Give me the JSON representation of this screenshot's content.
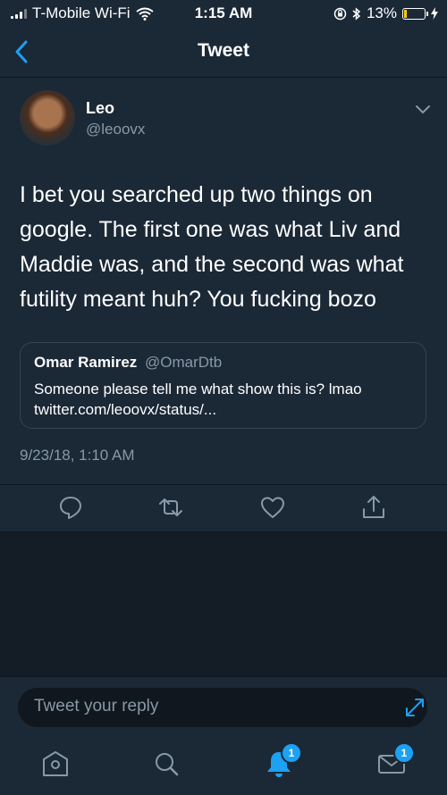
{
  "status_bar": {
    "carrier": "T-Mobile Wi-Fi",
    "time": "1:15 AM",
    "battery": "13%",
    "battery_level": 0.13
  },
  "nav": {
    "title": "Tweet",
    "back_icon": "back-chevron-icon"
  },
  "tweet": {
    "author_name": "Leo",
    "author_handle": "@leoovx",
    "text": "I bet you searched up two things on google. The first one was what Liv and Maddie was, and the second was what futility meant huh? You fucking bozo",
    "timestamp": "9/23/18, 1:10 AM",
    "quoted": {
      "name": "Omar Ramirez",
      "handle": "@OmarDtb",
      "text": "Someone please tell me what show this is? lmao twitter.com/leoovx/status/..."
    }
  },
  "actions": [
    "reply-icon",
    "retweet-icon",
    "like-icon",
    "share-icon"
  ],
  "reply": {
    "placeholder": "Tweet your reply"
  },
  "tabs": [
    {
      "icon": "home-icon",
      "badge": ""
    },
    {
      "icon": "search-icon",
      "badge": ""
    },
    {
      "icon": "notifications-icon",
      "badge": "1"
    },
    {
      "icon": "messages-icon",
      "badge": "1"
    }
  ],
  "colors": {
    "background": "#141d26",
    "surface": "#1b2836",
    "accent": "#1da1f2",
    "muted": "#8899a6"
  }
}
